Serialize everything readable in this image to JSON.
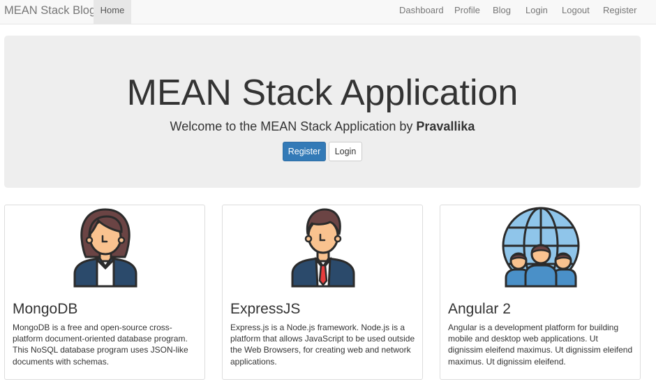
{
  "navbar": {
    "brand": "MEAN Stack Blog",
    "home": "Home",
    "links": [
      "Dashboard",
      "Profile",
      "Blog",
      "Login",
      "Logout",
      "Register"
    ]
  },
  "jumbotron": {
    "title": "MEAN Stack Application",
    "subtitle_prefix": "Welcome to the MEAN Stack Application by",
    "subtitle_name": "Pravallika",
    "register_label": "Register",
    "login_label": "Login"
  },
  "cards": [
    {
      "title": "MongoDB",
      "text": "MongoDB is a free and open-source cross-platform document-oriented database program. This NoSQL database program uses JSON-like documents with schemas.",
      "icon": "businesswoman-icon"
    },
    {
      "title": "ExpressJS",
      "text": "Express.js is a Node.js framework. Node.js is a platform that allows JavaScript to be used outside the Web Browsers, for creating web and network applications.",
      "icon": "businessman-icon"
    },
    {
      "title": "Angular 2",
      "text": "Angular is a development platform for building mobile and desktop web applications. Ut dignissim eleifend maximus. Ut dignissim eleifend maximus. Ut dignissim eleifend.",
      "icon": "global-team-icon"
    }
  ],
  "colors": {
    "primary": "#337ab7",
    "navbar_bg": "#f8f8f8",
    "jumbotron_bg": "#eeeeee",
    "icon_outline": "#2b2b2b",
    "hair": "#6b4444",
    "skin": "#f9c28f",
    "suit": "#2b4a6b",
    "tie": "#e63c3c",
    "globe": "#8fc5ea"
  }
}
